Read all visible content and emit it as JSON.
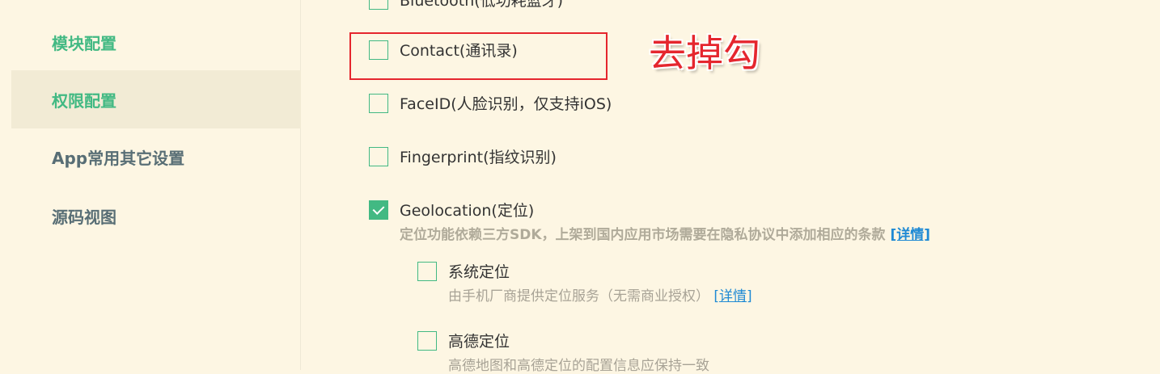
{
  "sidebar": {
    "items": [
      {
        "label": "模块配置"
      },
      {
        "label": "权限配置"
      },
      {
        "label": "App常用其它设置"
      },
      {
        "label": "源码视图"
      }
    ]
  },
  "permissions": {
    "bluetooth": {
      "label": "Bluetooth(低功耗蓝牙)",
      "checked": false
    },
    "contact": {
      "label": "Contact(通讯录)",
      "checked": false
    },
    "faceid": {
      "label": "FaceID(人脸识别，仅支持iOS)",
      "checked": false
    },
    "fingerprint": {
      "label": "Fingerprint(指纹识别)",
      "checked": false
    },
    "geolocation": {
      "label": "Geolocation(定位)",
      "checked": true,
      "desc": "定位功能依赖三方SDK，上架到国内应用市场需要在隐私协议中添加相应的条款",
      "link": "[详情]"
    },
    "system_location": {
      "label": "系统定位",
      "checked": false,
      "desc": "由手机厂商提供定位服务（无需商业授权）",
      "link": "[详情]"
    },
    "amap_location": {
      "label": "高德定位",
      "checked": false,
      "desc": "高德地图和高德定位的配置信息应保持一致"
    }
  },
  "annotation": {
    "text": "去掉勾",
    "color": "#e5262e"
  },
  "colors": {
    "accent": "#42b983",
    "background": "#fdf6e3",
    "link": "#1f8ad4"
  }
}
